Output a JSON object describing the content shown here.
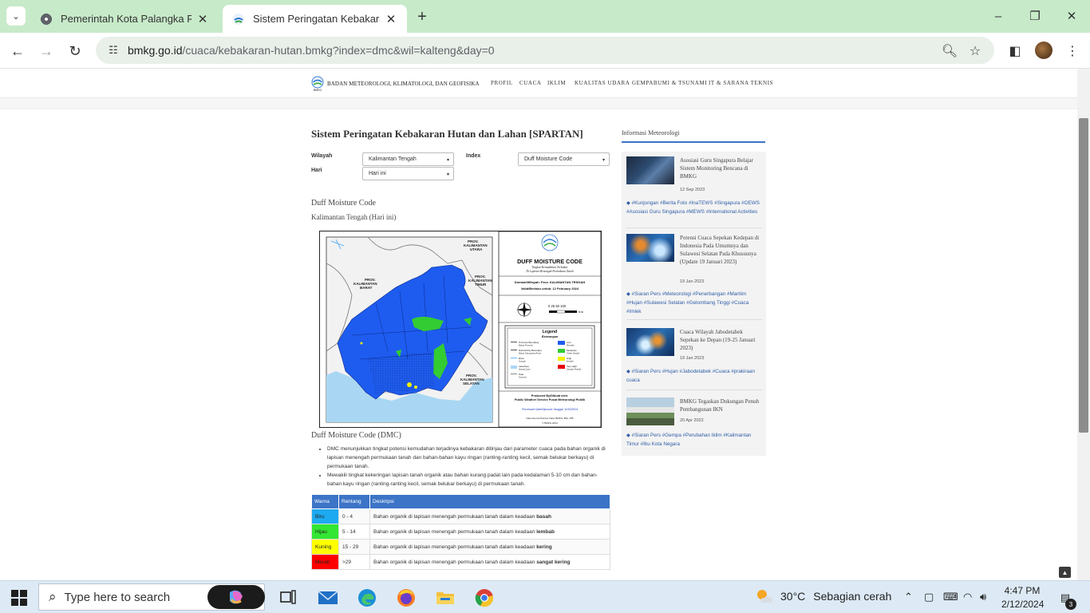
{
  "browser": {
    "tabs": [
      {
        "title": "Pemerintah Kota Palangka Raya",
        "active": false
      },
      {
        "title": "Sistem Peringatan Kebakaran H",
        "active": true
      }
    ],
    "url_host": "bmkg.go.id",
    "url_path": "/cuaca/kebakaran-hutan.bmkg?index=dmc&wil=kalteng&day=0"
  },
  "site": {
    "logo_text": "BADAN METEOROLOGI, KLIMATOLOGI, DAN GEOFISIKA",
    "logo_sub": "BMKG",
    "menu": [
      "PROFIL",
      "CUACA",
      "IKLIM",
      "KUALITAS UDARA",
      "GEMPABUMI & TSUNAMI",
      "IT & SARANA TEKNIS"
    ]
  },
  "main": {
    "title": "Sistem Peringatan Kebakaran Hutan dan Lahan [SPARTAN]",
    "filters": {
      "wilayah_label": "Wilayah",
      "wilayah_value": "Kalimantan Tengah",
      "hari_label": "Hari",
      "hari_value": "Hari ini",
      "index_label": "Index",
      "index_value": "Duff Moisture Code"
    },
    "section_title": "Duff Moisture Code",
    "section_subtitle": "Kalimantan Tengah (Hari ini)",
    "map": {
      "title": "DUFF MOISTURE CODE",
      "subtitle1": "Tingkat Kemudahan Terbakar",
      "subtitle2": "Di Lapisan Menengah Permukaan Tanah",
      "domain": "Domain/Wilayah: Prov. KALIMANTAN TENGAH",
      "valid": "Valid/Berlaku untuk: 12 February 2024",
      "scale": "0  25 50        100",
      "scale_unit": "Km",
      "legend_title": "Legend",
      "legend_sub": "Keterangan",
      "legend_items": [
        {
          "label": "Province Boundary",
          "sub": "Batas Provinsi"
        },
        {
          "label": "District/City Boundary",
          "sub": "Batas Kabupaten/Kota"
        },
        {
          "label": "River",
          "sub": "Sungai"
        },
        {
          "label": "Lake/Sea",
          "sub": "Danau/Laut"
        },
        {
          "label": "Peat",
          "sub": "Gambut"
        }
      ],
      "legend_classes": [
        {
          "label": "Low",
          "sub": "Rendah",
          "color": "#1e5cf0"
        },
        {
          "label": "Moderate",
          "sub": "Tidak Mudah",
          "color": "#33cc33"
        },
        {
          "label": "High",
          "sub": "Mudah",
          "color": "#f2f200"
        },
        {
          "label": "Very High",
          "sub": "Sangat Mudah",
          "color": "#e60000"
        }
      ],
      "credit_title": "Produced By/Dibuat oleh:",
      "credit_org": "Public Weather Service Pusat Meteorologi Publik",
      "credit_date": "Processed Date/Diproses Tanggal: 11/02/2024",
      "credit_src": "Data Source/Sumber Data: BMKG, BIG, IPB",
      "copyright": "© BMKG 2024",
      "regions": {
        "kalbar": "PROV.\nKALIMANTAN\nBARAT",
        "kaltara": "PROV.\nKALIMANTAN\nUTARA",
        "kaltim": "PROV.\nKALIMANTAN\nTIMUR",
        "kalsel": "PROV.\nKALIMANTAN\nSELATAN"
      }
    },
    "dmc_title": "Duff Moisture Code (DMC)",
    "bullets": [
      "DMC menunjukkan tingkat potensi kemudahan terjadinya kebakaran ditinjau dari parameter cuaca pada bahan organik di lapisan menengah permukaan tanah dan bahan-bahan kayu ringan (ranting-ranting kecil, semak belukar berkayu) di permukaan tanah.",
      "Mewakili tingkat kekeringan lapisan tanah organik atau bahan kurang padat lain pada kedalaman 5-10 cm dan bahan-bahan kayu ringan (ranting-ranting kecil, semak belukar berkayu) di permukaan tanah."
    ],
    "legend_table": {
      "headers": [
        "Warna",
        "Rentang",
        "Deskripsi"
      ],
      "rows": [
        {
          "warna": "Biru",
          "color": "#1eaaf0",
          "rentang": "0 - 4",
          "desc": "Bahan organik di lapisan menengah permukaan tanah dalam keadaan",
          "bold": "basah"
        },
        {
          "warna": "Hijau",
          "color": "#33e633",
          "rentang": "5 - 14",
          "desc": "Bahan organik di lapisan menengah permukaan tanah dalam keadaan",
          "bold": "lembab"
        },
        {
          "warna": "Kuning",
          "color": "#ffff00",
          "rentang": "15 - 29",
          "desc": "Bahan organik di lapisan menengah permukaan tanah dalam keadaan",
          "bold": "kering"
        },
        {
          "warna": "Merah",
          "color": "#ff0000",
          "rentang": ">29",
          "desc": "Bahan organik di lapisan menengah permukaan tanah dalam keadaan",
          "bold": "sangat kering"
        }
      ]
    }
  },
  "sidebar": {
    "title": "Informasi Meteorologi",
    "news": [
      {
        "title": "Asosiasi Guru Singapura Belajar Sistem Monitoring Bencana di BMKG",
        "date": "12 Sep 2023",
        "tags": "#Kunjungan #Berita Foto #InaTEWS #Singapura #OEWS #Asosiasi Guru Singapura #MEWS #International Activities"
      },
      {
        "title": "Potensi Cuaca Sepekan Kedepan di Indonesia Pada Umumnya dan Sulawesi Selatan Pada Khususnya (Update 19 Januari 2023)",
        "date": "19 Jan 2023",
        "tags": "#Siaran Pers #Meteorologi #Penerbangan #Maritim #Hujan #Sulawesi Selatan #Gelombang Tinggi #Cuaca #Imlek"
      },
      {
        "title": "Cuaca Wilayah Jabodetabek Sepekan ke Depan (19-25 Januari 2023)",
        "date": "19 Jan 2023",
        "tags": "#Siaran Pers #Hujan #Jabodetabek #Cuaca #prakiraan cuaca"
      },
      {
        "title": "BMKG Tegaskan Dukungan Penuh Pembangunan IKN",
        "date": "20 Apr 2022",
        "tags": "#Siaran Pers #Gempa #Perubahan Iklim #Kalimantan Timur #Ibu Kota Negara"
      }
    ]
  },
  "taskbar": {
    "search_placeholder": "Type here to search",
    "weather_temp": "30°C",
    "weather_desc": "Sebagian cerah",
    "time": "4:47 PM",
    "date": "2/12/2024",
    "notif_count": "3"
  }
}
